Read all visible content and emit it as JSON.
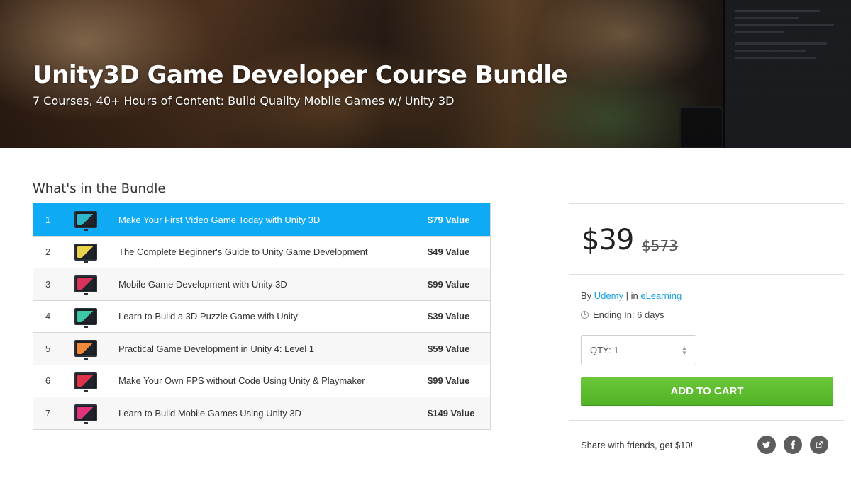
{
  "hero": {
    "title": "Unity3D Game Developer Course Bundle",
    "subtitle": "7 Courses, 40+ Hours of Content: Build Quality Mobile Games w/ Unity 3D"
  },
  "bundle": {
    "heading": "What's in the Bundle",
    "items": [
      {
        "num": "1",
        "title": "Make Your First Video Game Today with Unity 3D",
        "value": "$79 Value",
        "thumb_color": "#2fb8c9",
        "active": true
      },
      {
        "num": "2",
        "title": "The Complete Beginner's Guide to Unity Game Development",
        "value": "$49 Value",
        "thumb_color": "#e8d34a",
        "active": false
      },
      {
        "num": "3",
        "title": "Mobile Game Development with Unity 3D",
        "value": "$99 Value",
        "thumb_color": "#d8345b",
        "active": false
      },
      {
        "num": "4",
        "title": "Learn to Build a 3D Puzzle Game with Unity",
        "value": "$39 Value",
        "thumb_color": "#3cc8a4",
        "active": false
      },
      {
        "num": "5",
        "title": "Practical Game Development in Unity 4: Level 1",
        "value": "$59 Value",
        "thumb_color": "#f08a3a",
        "active": false
      },
      {
        "num": "6",
        "title": "Make Your Own FPS without Code Using Unity & Playmaker",
        "value": "$99 Value",
        "thumb_color": "#e0334a",
        "active": false
      },
      {
        "num": "7",
        "title": "Learn to Build Mobile Games Using Unity 3D",
        "value": "$149 Value",
        "thumb_color": "#e0337a",
        "active": false
      }
    ]
  },
  "purchase": {
    "price": "$39",
    "old_price": "$573",
    "by_label": "By",
    "vendor": "Udemy",
    "separator": "| in",
    "category": "eLearning",
    "ending": "Ending In: 6 days",
    "qty_label": "QTY: 1",
    "cart_label": "ADD TO CART",
    "share_text": "Share with friends, get $10!"
  },
  "colors": {
    "accent_blue": "#0faaf4",
    "cart_green": "#5bbd2d",
    "link_blue": "#1a9ee2"
  },
  "icons": [
    "clock-icon",
    "twitter-icon",
    "facebook-icon",
    "share-icon",
    "updown-arrows-icon"
  ]
}
